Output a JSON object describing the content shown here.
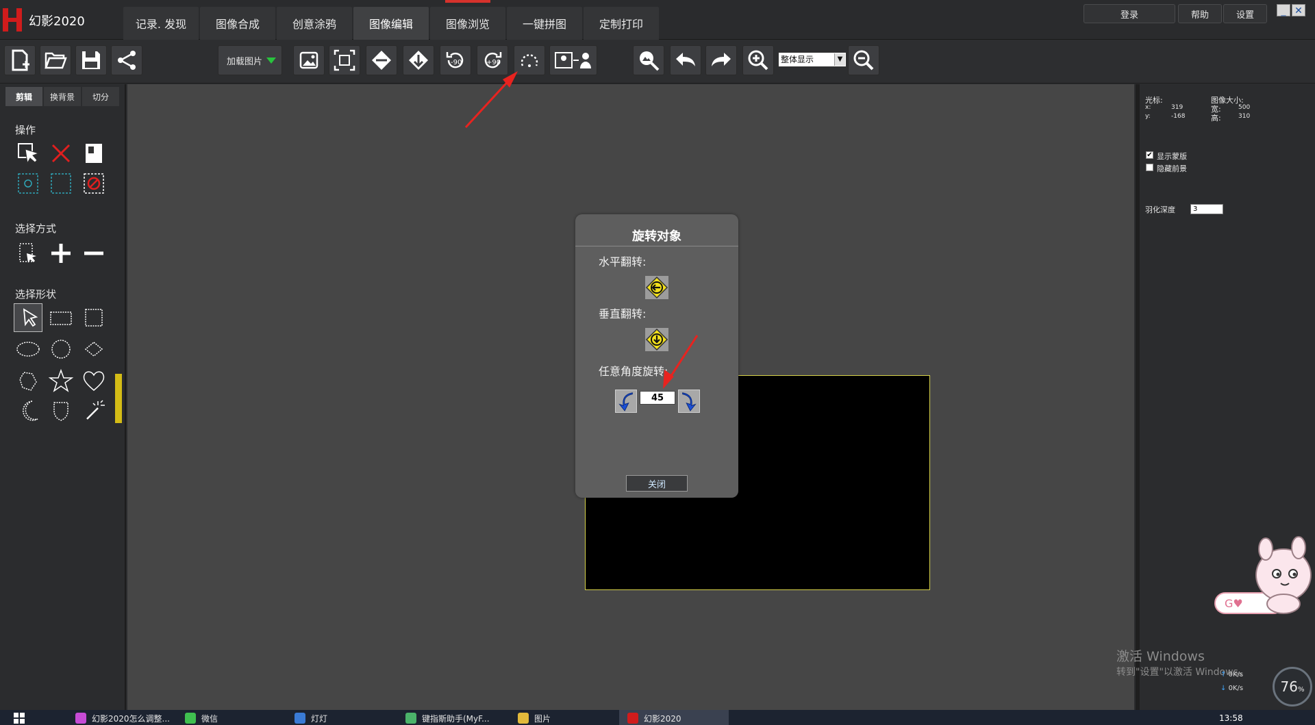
{
  "app": {
    "title": "幻影2020"
  },
  "menu": {
    "tabs": [
      {
        "label": "记录. 发现"
      },
      {
        "label": "图像合成"
      },
      {
        "label": "创意涂鸦"
      },
      {
        "label": "图像编辑"
      },
      {
        "label": "图像浏览"
      },
      {
        "label": "一键拼图"
      },
      {
        "label": "定制打印"
      }
    ],
    "active_tab": "图像编辑"
  },
  "top_buttons": {
    "login": "登录",
    "help": "帮助",
    "settings": "设置",
    "minimize": "_",
    "close": "✕"
  },
  "toolbar": {
    "load_image_label": "加载图片",
    "zoom_select_value": "整体显示",
    "accent_color": "#28c33d"
  },
  "left_panel": {
    "tabs": [
      {
        "label": "剪辑"
      },
      {
        "label": "换背景"
      },
      {
        "label": "切分"
      }
    ],
    "section_operation": "操作",
    "section_select_mode": "选择方式",
    "section_select_shape": "选择形状"
  },
  "dialog": {
    "title": "旋转对象",
    "horizontal_flip_label": "水平翻转:",
    "vertical_flip_label": "垂直翻转:",
    "free_rotate_label": "任意角度旋转:",
    "angle_value": "45",
    "close_label": "关闭"
  },
  "right_panel": {
    "cursor_label": "光标:",
    "x_label": "x:",
    "x_value": "319",
    "y_label": "y:",
    "y_value": "-168",
    "image_size_label": "图像大小:",
    "width_label": "宽:",
    "width_value": "500",
    "height_label": "高:",
    "height_value": "310",
    "show_mask_label": "显示蒙版",
    "show_mask_checked": true,
    "hide_fg_label": "隐藏前景",
    "hide_fg_checked": false,
    "feather_label": "羽化深度",
    "feather_value": "3"
  },
  "watermark": {
    "line1": "激活 Windows",
    "line2": "转到\"设置\"以激活 Windows。"
  },
  "speed_widget": {
    "up": "0K/s",
    "down": "0K/s",
    "percent": "76",
    "percent_suffix": "%"
  },
  "taskbar": {
    "items": [
      {
        "label": "幻影2020怎么调整..."
      },
      {
        "label": "微信"
      },
      {
        "label": "灯灯"
      },
      {
        "label": "键指斯助手(MyF..."
      },
      {
        "label": "图片"
      },
      {
        "label": "幻影2020"
      }
    ],
    "time": "13:58"
  }
}
